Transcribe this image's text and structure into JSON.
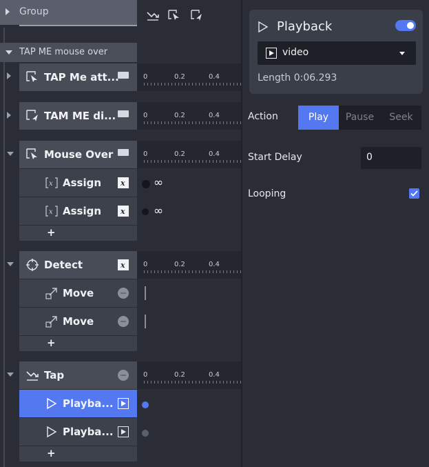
{
  "group": {
    "label": "Group"
  },
  "layer": {
    "label": "TAP ME mouse over"
  },
  "timeline_ticks": [
    "0",
    "0.2",
    "0.4"
  ],
  "rows": {
    "tap_me_att": {
      "label": "TAP Me att..."
    },
    "tam_me_di": {
      "label": "TAM ME di..."
    },
    "mouse_over": {
      "label": "Mouse Over"
    },
    "assign1": {
      "label": "Assign"
    },
    "assign2": {
      "label": "Assign"
    },
    "detect": {
      "label": "Detect"
    },
    "move1": {
      "label": "Move"
    },
    "move2": {
      "label": "Move"
    },
    "tap": {
      "label": "Tap"
    },
    "playback1": {
      "label": "Playba..."
    },
    "playback2": {
      "label": "Playba..."
    }
  },
  "infinity_symbol": "∞",
  "add_symbol": "+",
  "panel": {
    "title": "Playback",
    "enabled": true,
    "source_value": "video",
    "length": "Length 0:06.293",
    "action_label": "Action",
    "action_options": [
      "Play",
      "Pause",
      "Seek"
    ],
    "action_selected": "Play",
    "start_delay_label": "Start Delay",
    "start_delay_value": "0",
    "looping_label": "Looping",
    "looping_checked": true
  },
  "colors": {
    "accent": "#5478f0",
    "background": "#2a2d36",
    "row": "#3d414b"
  },
  "icons": [
    "tap-enter-icon",
    "tap-exit-icon",
    "tap-icon",
    "cursor-icon",
    "crosshair-icon",
    "move-icon",
    "play-icon",
    "variable-icon",
    "video-file-icon"
  ]
}
